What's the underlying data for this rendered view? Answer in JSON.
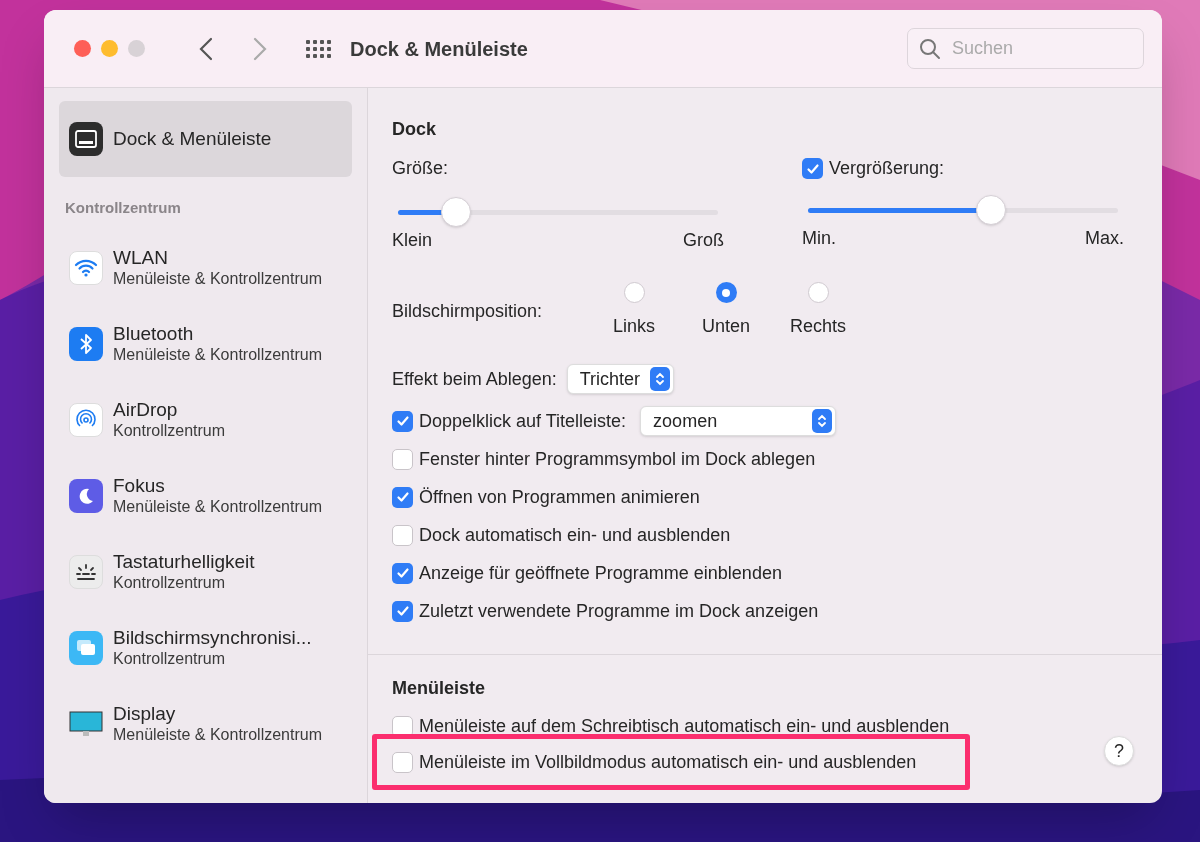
{
  "window": {
    "title": "Dock & Menüleiste"
  },
  "search": {
    "placeholder": "Suchen"
  },
  "sidebar": {
    "top_items": [
      {
        "kind": "dock",
        "title": "Dock & Menüleiste",
        "selected": true
      }
    ],
    "section": "Kontrollzentrum",
    "items": [
      {
        "kind": "wifi",
        "title": "WLAN",
        "subtitle": "Menüleiste & Kontrollzentrum",
        "selected": false
      },
      {
        "kind": "bluetooth",
        "title": "Bluetooth",
        "subtitle": "Menüleiste & Kontrollzentrum",
        "selected": false
      },
      {
        "kind": "airdrop",
        "title": "AirDrop",
        "subtitle": "Kontrollzentrum",
        "selected": false
      },
      {
        "kind": "focus",
        "title": "Fokus",
        "subtitle": "Menüleiste & Kontrollzentrum",
        "selected": false
      },
      {
        "kind": "keyboard",
        "title": "Tastaturhelligkeit",
        "subtitle": "Kontrollzentrum",
        "selected": false
      },
      {
        "kind": "screens",
        "title": "Bildschirmsynchronisi...",
        "subtitle": "Kontrollzentrum",
        "selected": false
      },
      {
        "kind": "display",
        "title": "Display",
        "subtitle": "Menüleiste & Kontrollzentrum",
        "selected": false
      }
    ]
  },
  "dock": {
    "heading": "Dock",
    "size": {
      "label": "Größe:",
      "level": 0.18,
      "min": "Klein",
      "max": "Groß"
    },
    "magnification": {
      "label": "Vergrößerung:",
      "checked": true,
      "level": 0.59,
      "min": "Min.",
      "max": "Max."
    },
    "position": {
      "label": "Bildschirmposition:",
      "options": [
        {
          "label": "Links",
          "selected": false
        },
        {
          "label": "Unten",
          "selected": true
        },
        {
          "label": "Rechts",
          "selected": false
        }
      ]
    },
    "effect": {
      "label": "Effekt beim Ablegen:",
      "value": "Trichter"
    },
    "options": [
      {
        "kind": "select",
        "label": "Doppelklick auf Titelleiste:",
        "checked": true,
        "value": "zoomen"
      },
      {
        "kind": "plain",
        "label": "Fenster hinter Programmsymbol im Dock ablegen",
        "checked": false
      },
      {
        "kind": "plain",
        "label": "Öffnen von Programmen animieren",
        "checked": true
      },
      {
        "kind": "plain",
        "label": "Dock automatisch ein- und ausblenden",
        "checked": false
      },
      {
        "kind": "plain",
        "label": "Anzeige für geöffnete Programme einblenden",
        "checked": true
      },
      {
        "kind": "plain",
        "label": "Zuletzt verwendete Programme im Dock anzeigen",
        "checked": true
      }
    ]
  },
  "menubar": {
    "heading": "Menüleiste",
    "options": [
      {
        "label": "Menüleiste auf dem Schreibtisch automatisch ein- und ausblenden",
        "checked": false,
        "highlighted": false
      },
      {
        "label": "Menüleiste im Vollbildmodus automatisch ein- und ausblenden",
        "checked": false,
        "highlighted": true
      }
    ]
  },
  "help": {
    "label": "?"
  }
}
